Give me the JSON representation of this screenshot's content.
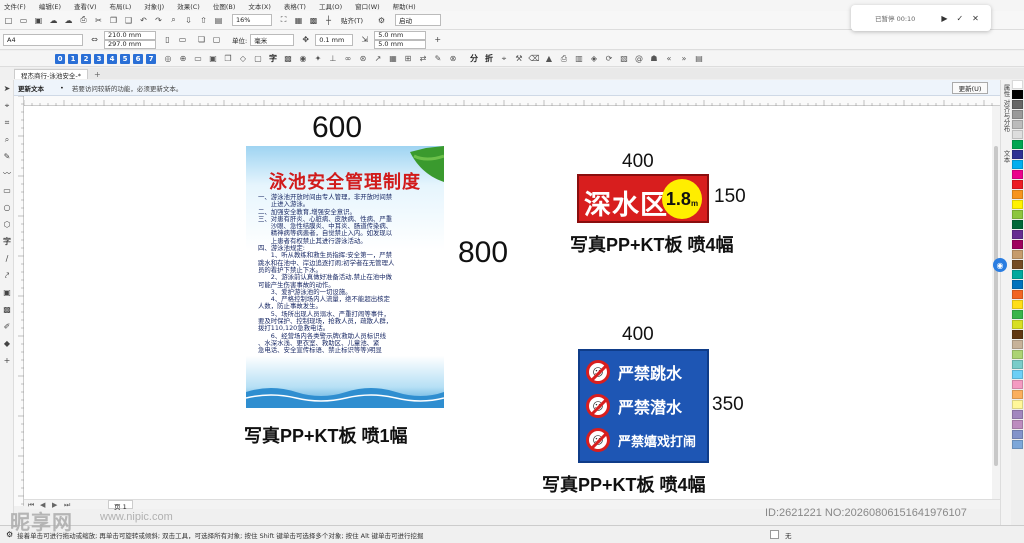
{
  "menu": [
    "文件(F)",
    "编辑(E)",
    "查看(V)",
    "布局(L)",
    "对象(J)",
    "效果(C)",
    "位图(B)",
    "文本(X)",
    "表格(T)",
    "工具(O)",
    "窗口(W)",
    "帮助(H)"
  ],
  "toolbar": {
    "zoom": "16%",
    "snap_label": "贴齐(T)",
    "launch_label": "启动"
  },
  "property_bar": {
    "page_size": "A4",
    "width": "210.0 mm",
    "height": "297.0 mm",
    "units_label": "单位:",
    "units": "毫米",
    "nudge": "0.1 mm",
    "dup_x": "5.0 mm",
    "dup_y": "5.0 mm"
  },
  "text_toolbar": {
    "nums": [
      "0",
      "1",
      "2",
      "3",
      "4",
      "5",
      "6",
      "7"
    ],
    "char_labels": [
      "字",
      "分",
      "折"
    ]
  },
  "tabs": {
    "active": "程杰商行-泳池安全-*"
  },
  "notification": {
    "title": "更新文本",
    "message": "若要访问较新的功能，必须更新文本。",
    "button": "更新(U)"
  },
  "docker": {
    "properties_label": "属性 对齐与分布",
    "text_label": "文本"
  },
  "canvas": {
    "poster_width": "600",
    "poster_height": "800",
    "poster_caption": "写真PP+KT板   喷1幅",
    "deep_width": "400",
    "deep_height": "150",
    "deep_caption": "写真PP+KT板   喷4幅",
    "ban_width": "400",
    "ban_height": "350",
    "ban_caption": "写真PP+KT板   喷4幅"
  },
  "poster": {
    "title": "泳池安全管理制度",
    "lines": [
      "一、游泳池开放时间由专人管理，非开放时间禁",
      "　　止进入游泳。",
      "二、加强安全教育,增强安全意识。",
      "三、对患有肝炎、心脏病、皮肤病、性病、严重",
      "　　沙眼、急性结膜炎、中耳炎、肠道传染病、",
      "　　精神病等病患者，自觉禁止入内。如发现以",
      "　　上患者有权禁止其进行游泳活动。",
      "四、游泳池规定:",
      "　　1、听从教练和救生员指挥:安全第一，严禁",
      "跳水和在池中、岸边追逐打闹;初学者在无管理人",
      "员的看护下禁止下水。",
      "　　2、游泳前认真做好准备活动,禁止在池中做",
      "可能产生伤害事故的动作。",
      "　　3、爱护游泳池的一切设施。",
      "　　4、严格控制场内人流量，绝不能超出核定",
      "人数，防止事故发生。",
      "　　5、场所出现人员溺水、严重打闹等事件，",
      "要及时保护、控制现场，抢救人员，疏散人群，",
      "拨打110,120急救电话。",
      "　　6、经营场内各类警示牌(救助人员标识线",
      "、水深水浅、更衣室、救助区、儿童池、紧",
      "急电话、安全宣传标语、禁止标识等等)明显"
    ]
  },
  "deep_sign": {
    "text": "深水区",
    "depth": "1.8",
    "unit": "m"
  },
  "ban_sign": {
    "rows": [
      "严禁跳水",
      "严禁潜水",
      "严禁嬉戏打闹"
    ]
  },
  "page_tab": "页 1",
  "status": {
    "hint": "接着单击可进行拖动或缩放; 再单击可旋转或倾斜; 双击工具，可选择所有对象; 按住 Shift 键单击可选择多个对象; 按住 Alt 键单击可进行挖掘",
    "fill": "无"
  },
  "recorder": {
    "status": "已暂停 00:10"
  },
  "watermark": {
    "brand": "昵享网",
    "url": "www.nipic.com",
    "id_text": "ID:2621221 NO:20260806151641976107"
  },
  "palette": [
    "#ffffff",
    "#000000",
    "#666666",
    "#999999",
    "#bbbbbb",
    "#dddddd",
    "#00a651",
    "#2e3192",
    "#00aeef",
    "#ec008c",
    "#ed1c24",
    "#f7941d",
    "#fff200",
    "#8dc63f",
    "#006838",
    "#662d91",
    "#9e005d",
    "#c69c6d",
    "#754c24",
    "#00a99d",
    "#0072bc",
    "#f26522",
    "#ffde17",
    "#39b54a",
    "#d7df23",
    "#603913",
    "#c7b299",
    "#acd373",
    "#7accc8",
    "#6dcff6",
    "#f49ac1",
    "#fbaf5d",
    "#fff799",
    "#a187be",
    "#bd8cbf",
    "#8393ca",
    "#7da7d9"
  ]
}
